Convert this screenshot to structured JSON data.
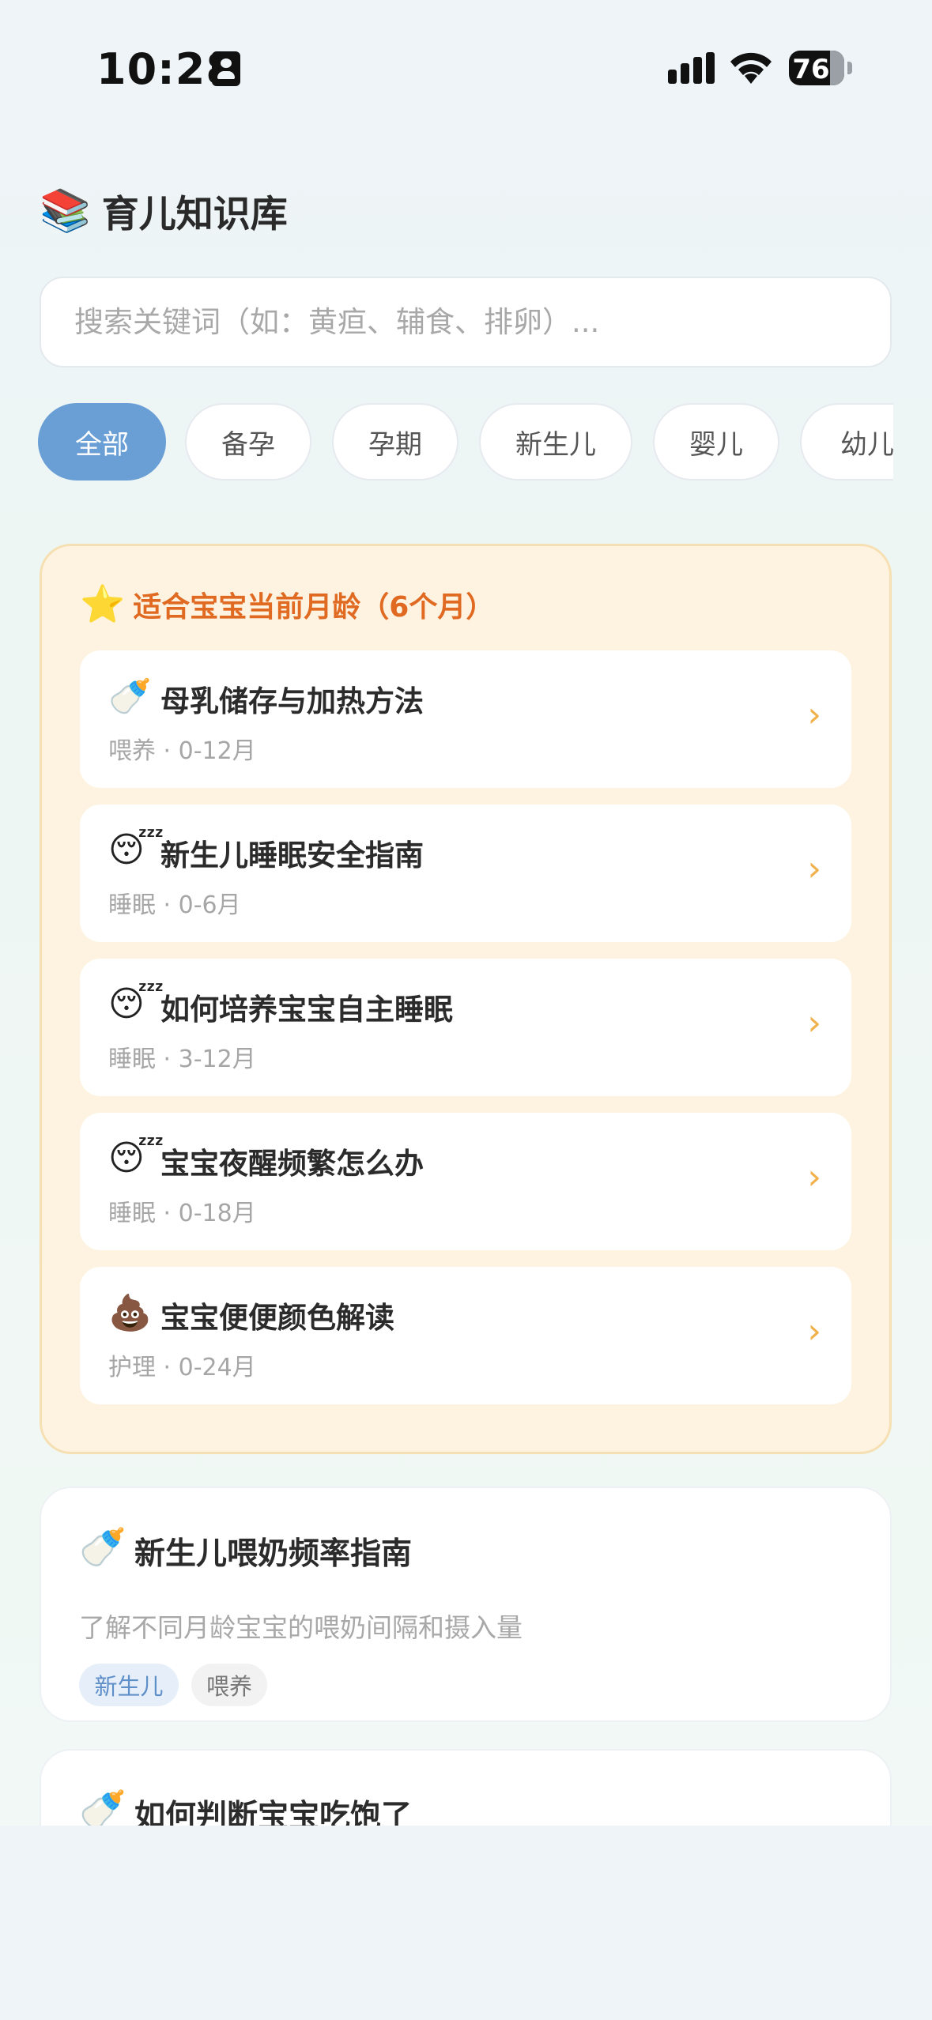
{
  "status_bar": {
    "time": "10:28",
    "battery": "76"
  },
  "header": {
    "icon": "books-icon",
    "title": "育儿知识库"
  },
  "search": {
    "placeholder": "搜索关键词（如：黄疸、辅食、排卵）..."
  },
  "filters": [
    {
      "label": "全部",
      "active": true
    },
    {
      "label": "备孕",
      "active": false
    },
    {
      "label": "孕期",
      "active": false
    },
    {
      "label": "新生儿",
      "active": false
    },
    {
      "label": "婴儿",
      "active": false
    },
    {
      "label": "幼儿",
      "active": false
    }
  ],
  "recommended": {
    "title": "适合宝宝当前月龄（6个月）",
    "items": [
      {
        "emoji": "🍼",
        "title": "母乳储存与加热方法",
        "meta": "喂养 · 0-12月"
      },
      {
        "emoji": "😴",
        "title": "新生儿睡眠安全指南",
        "meta": "睡眠 · 0-6月"
      },
      {
        "emoji": "😴",
        "title": "如何培养宝宝自主睡眠",
        "meta": "睡眠 · 3-12月"
      },
      {
        "emoji": "😴",
        "title": "宝宝夜醒频繁怎么办",
        "meta": "睡眠 · 0-18月"
      },
      {
        "emoji": "💩",
        "title": "宝宝便便颜色解读",
        "meta": "护理 · 0-24月"
      }
    ]
  },
  "articles": [
    {
      "emoji": "🍼",
      "title": "新生儿喂奶频率指南",
      "desc": "了解不同月龄宝宝的喂奶间隔和摄入量",
      "tags": [
        "新生儿",
        "喂养"
      ]
    },
    {
      "emoji": "🍼",
      "title": "如何判断宝宝吃饱了"
    }
  ],
  "colors": {
    "accent_blue": "#6a9fd6",
    "recommend_orange": "#e06a22",
    "recommend_bg": "#fdf3e0",
    "chevron": "#f0b04a"
  }
}
